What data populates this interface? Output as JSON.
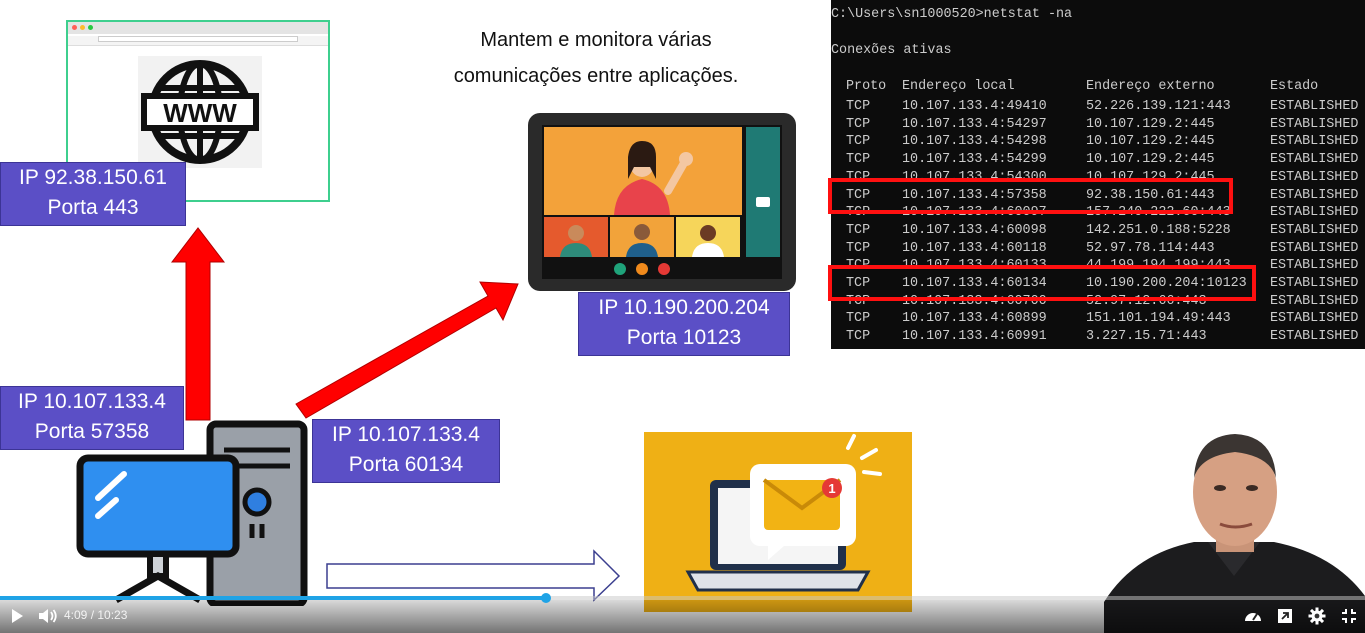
{
  "caption": {
    "line1": "Mantem e monitora várias",
    "line2": "comunicações entre aplicações."
  },
  "labels": {
    "server": {
      "ip": "IP 92.38.150.61",
      "port": "Porta 443"
    },
    "video": {
      "ip": "IP 10.190.200.204",
      "port": "Porta 10123"
    },
    "client_a": {
      "ip": "IP 10.107.133.4",
      "port": "Porta 57358"
    },
    "client_b": {
      "ip": "IP 10.107.133.4",
      "port": "Porta 60134"
    }
  },
  "terminal": {
    "prompt": "C:\\Users\\sn1000520>netstat -na",
    "section": "Conexões ativas",
    "headers": {
      "proto": "Proto",
      "local": "Endereço local",
      "external": "Endereço externo",
      "state": "Estado"
    },
    "rows": [
      {
        "proto": "TCP",
        "local": "10.107.133.4:49410",
        "external": "52.226.139.121:443",
        "state": "ESTABLISHED"
      },
      {
        "proto": "TCP",
        "local": "10.107.133.4:54297",
        "external": "10.107.129.2:445",
        "state": "ESTABLISHED"
      },
      {
        "proto": "TCP",
        "local": "10.107.133.4:54298",
        "external": "10.107.129.2:445",
        "state": "ESTABLISHED"
      },
      {
        "proto": "TCP",
        "local": "10.107.133.4:54299",
        "external": "10.107.129.2:445",
        "state": "ESTABLISHED"
      },
      {
        "proto": "TCP",
        "local": "10.107.133.4:54300",
        "external": "10.107.129.2:445",
        "state": "ESTABLISHED"
      },
      {
        "proto": "TCP",
        "local": "10.107.133.4:57358",
        "external": "92.38.150.61:443",
        "state": "ESTABLISHED"
      },
      {
        "proto": "TCP",
        "local": "10.107.133.4:60097",
        "external": "157.240.222.60:443",
        "state": "ESTABLISHED"
      },
      {
        "proto": "TCP",
        "local": "10.107.133.4:60098",
        "external": "142.251.0.188:5228",
        "state": "ESTABLISHED"
      },
      {
        "proto": "TCP",
        "local": "10.107.133.4:60118",
        "external": "52.97.78.114:443",
        "state": "ESTABLISHED"
      },
      {
        "proto": "TCP",
        "local": "10.107.133.4:60133",
        "external": "44.199.194.199:443",
        "state": "ESTABLISHED"
      },
      {
        "proto": "TCP",
        "local": "10.107.133.4:60134",
        "external": "10.190.200.204:10123",
        "state": "ESTABLISHED"
      },
      {
        "proto": "TCP",
        "local": "10.107.133.4:60700",
        "external": "52.97.12.66:443",
        "state": "ESTABLISHED"
      },
      {
        "proto": "TCP",
        "local": "10.107.133.4:60899",
        "external": "151.101.194.49:443",
        "state": "ESTABLISHED"
      },
      {
        "proto": "TCP",
        "local": "10.107.133.4:60991",
        "external": "3.227.15.71:443",
        "state": "ESTABLISHED"
      }
    ],
    "highlighted_rows": [
      5,
      10
    ]
  },
  "player": {
    "time": "4:09 / 10:23",
    "progress": 0.4
  },
  "colors": {
    "label_bg": "#5b4fc6",
    "arrow": "#ff0000",
    "highlight": "#ff1010",
    "progress": "#1fa3e6",
    "mail_bg": "#efb015"
  },
  "icons": {
    "globe": "www-globe-icon",
    "computer": "desktop-computer-icon",
    "tablet": "video-call-tablet-icon",
    "mail": "laptop-mail-notification-icon",
    "play": "play-icon",
    "volume": "volume-icon",
    "speed": "speed-icon",
    "pip": "picture-in-picture-icon",
    "settings": "gear-icon",
    "fullscreen": "exit-fullscreen-icon"
  }
}
